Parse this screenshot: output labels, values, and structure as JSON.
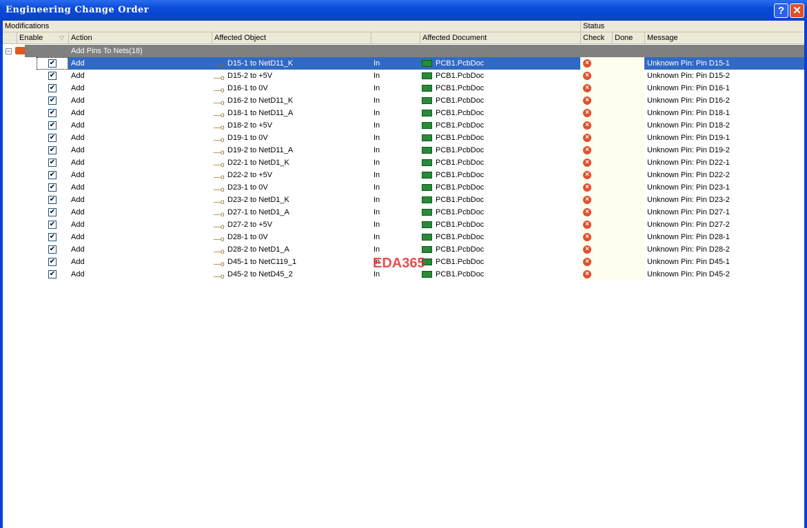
{
  "window": {
    "title": "Engineering Change Order",
    "help": "?",
    "close": "✕"
  },
  "headers": {
    "modifications": "Modifications",
    "status": "Status",
    "enable": "Enable",
    "sort": "▽",
    "action": "Action",
    "object": "Affected Object",
    "document": "Affected Document",
    "check": "Check",
    "done": "Done",
    "message": "Message"
  },
  "group": {
    "label": "Add Pins To Nets(18)",
    "toggle": "−"
  },
  "watermark": "EDA365",
  "rows": [
    {
      "action": "Add",
      "object": "D15-1 to NetD11_K",
      "dir": "In",
      "doc": "PCB1.PcbDoc",
      "message": "Unknown Pin: Pin D15-1"
    },
    {
      "action": "Add",
      "object": "D15-2 to +5V",
      "dir": "In",
      "doc": "PCB1.PcbDoc",
      "message": "Unknown Pin: Pin D15-2"
    },
    {
      "action": "Add",
      "object": "D16-1 to 0V",
      "dir": "In",
      "doc": "PCB1.PcbDoc",
      "message": "Unknown Pin: Pin D16-1"
    },
    {
      "action": "Add",
      "object": "D16-2 to NetD11_K",
      "dir": "In",
      "doc": "PCB1.PcbDoc",
      "message": "Unknown Pin: Pin D16-2"
    },
    {
      "action": "Add",
      "object": "D18-1 to NetD11_A",
      "dir": "In",
      "doc": "PCB1.PcbDoc",
      "message": "Unknown Pin: Pin D18-1"
    },
    {
      "action": "Add",
      "object": "D18-2 to +5V",
      "dir": "In",
      "doc": "PCB1.PcbDoc",
      "message": "Unknown Pin: Pin D18-2"
    },
    {
      "action": "Add",
      "object": "D19-1 to 0V",
      "dir": "In",
      "doc": "PCB1.PcbDoc",
      "message": "Unknown Pin: Pin D19-1"
    },
    {
      "action": "Add",
      "object": "D19-2 to NetD11_A",
      "dir": "In",
      "doc": "PCB1.PcbDoc",
      "message": "Unknown Pin: Pin D19-2"
    },
    {
      "action": "Add",
      "object": "D22-1 to NetD1_K",
      "dir": "In",
      "doc": "PCB1.PcbDoc",
      "message": "Unknown Pin: Pin D22-1"
    },
    {
      "action": "Add",
      "object": "D22-2 to +5V",
      "dir": "In",
      "doc": "PCB1.PcbDoc",
      "message": "Unknown Pin: Pin D22-2"
    },
    {
      "action": "Add",
      "object": "D23-1 to 0V",
      "dir": "In",
      "doc": "PCB1.PcbDoc",
      "message": "Unknown Pin: Pin D23-1"
    },
    {
      "action": "Add",
      "object": "D23-2 to NetD1_K",
      "dir": "In",
      "doc": "PCB1.PcbDoc",
      "message": "Unknown Pin: Pin D23-2"
    },
    {
      "action": "Add",
      "object": "D27-1 to NetD1_A",
      "dir": "In",
      "doc": "PCB1.PcbDoc",
      "message": "Unknown Pin: Pin D27-1"
    },
    {
      "action": "Add",
      "object": "D27-2 to +5V",
      "dir": "In",
      "doc": "PCB1.PcbDoc",
      "message": "Unknown Pin: Pin D27-2"
    },
    {
      "action": "Add",
      "object": "D28-1 to 0V",
      "dir": "In",
      "doc": "PCB1.PcbDoc",
      "message": "Unknown Pin: Pin D28-1"
    },
    {
      "action": "Add",
      "object": "D28-2 to NetD1_A",
      "dir": "In",
      "doc": "PCB1.PcbDoc",
      "message": "Unknown Pin: Pin D28-2"
    },
    {
      "action": "Add",
      "object": "D45-1 to NetC119_1",
      "dir": "In",
      "doc": "PCB1.PcbDoc",
      "message": "Unknown Pin: Pin D45-1"
    },
    {
      "action": "Add",
      "object": "D45-2 to NetD45_2",
      "dir": "In",
      "doc": "PCB1.PcbDoc",
      "message": "Unknown Pin: Pin D45-2"
    }
  ]
}
